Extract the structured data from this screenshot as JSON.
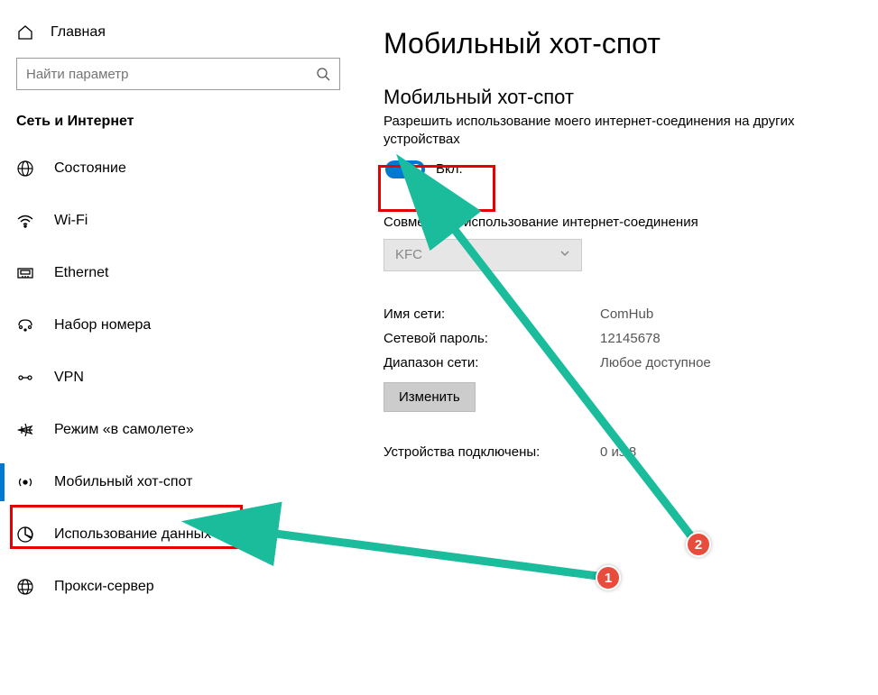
{
  "sidebar": {
    "home_label": "Главная",
    "search_placeholder": "Найти параметр",
    "category_title": "Сеть и Интернет",
    "items": [
      {
        "id": "status",
        "label": "Состояние",
        "icon": "globe"
      },
      {
        "id": "wifi",
        "label": "Wi-Fi",
        "icon": "wifi"
      },
      {
        "id": "ethernet",
        "label": "Ethernet",
        "icon": "ethernet"
      },
      {
        "id": "dialup",
        "label": "Набор номера",
        "icon": "dialup"
      },
      {
        "id": "vpn",
        "label": "VPN",
        "icon": "vpn"
      },
      {
        "id": "airplane",
        "label": "Режим «в самолете»",
        "icon": "airplane"
      },
      {
        "id": "hotspot",
        "label": "Мобильный хот-спот",
        "icon": "hotspot",
        "active": true,
        "highlighted": true
      },
      {
        "id": "datausage",
        "label": "Использование данных",
        "icon": "datausage"
      },
      {
        "id": "proxy",
        "label": "Прокси-сервер",
        "icon": "proxy"
      }
    ]
  },
  "main": {
    "page_title": "Мобильный хот-спот",
    "section_title": "Мобильный хот-спот",
    "section_desc": "Разрешить использование моего интернет-соединения на других устройствах",
    "toggle_state_label": "Вкл.",
    "toggle_on": true,
    "share_section_title": "Совместное использование интернет-соединения",
    "share_dropdown_value": "KFC",
    "kv": {
      "network_name_label": "Имя сети:",
      "network_name_value": "ComHub",
      "password_label": "Сетевой пароль:",
      "password_value": "12145678",
      "band_label": "Диапазон сети:",
      "band_value": "Любое доступное"
    },
    "change_button_label": "Изменить",
    "devices_label": "Устройства подключены:",
    "devices_value": "0 из 8"
  },
  "annotations": {
    "badge1": "1",
    "badge2": "2"
  }
}
